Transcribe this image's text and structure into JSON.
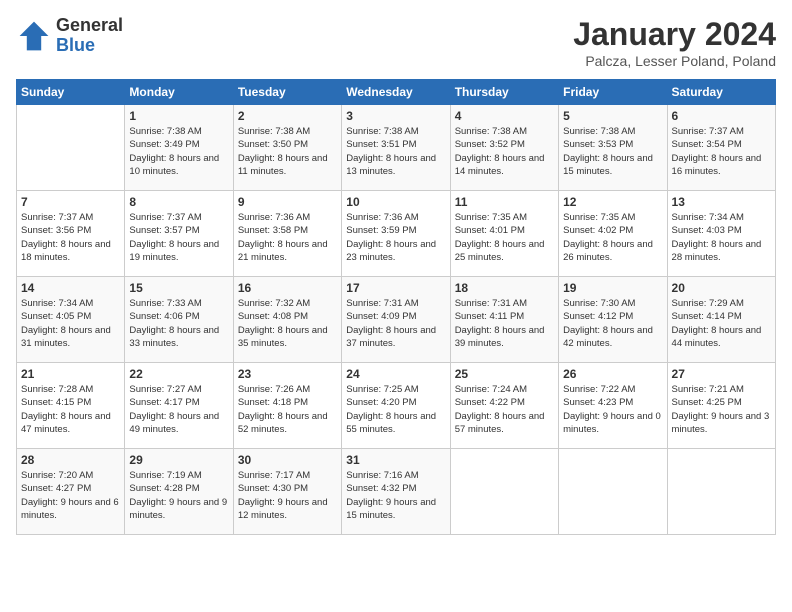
{
  "logo": {
    "general": "General",
    "blue": "Blue"
  },
  "title": "January 2024",
  "subtitle": "Palcza, Lesser Poland, Poland",
  "weekdays": [
    "Sunday",
    "Monday",
    "Tuesday",
    "Wednesday",
    "Thursday",
    "Friday",
    "Saturday"
  ],
  "weeks": [
    [
      {
        "day": "",
        "sunrise": "",
        "sunset": "",
        "daylight": ""
      },
      {
        "day": "1",
        "sunrise": "Sunrise: 7:38 AM",
        "sunset": "Sunset: 3:49 PM",
        "daylight": "Daylight: 8 hours and 10 minutes."
      },
      {
        "day": "2",
        "sunrise": "Sunrise: 7:38 AM",
        "sunset": "Sunset: 3:50 PM",
        "daylight": "Daylight: 8 hours and 11 minutes."
      },
      {
        "day": "3",
        "sunrise": "Sunrise: 7:38 AM",
        "sunset": "Sunset: 3:51 PM",
        "daylight": "Daylight: 8 hours and 13 minutes."
      },
      {
        "day": "4",
        "sunrise": "Sunrise: 7:38 AM",
        "sunset": "Sunset: 3:52 PM",
        "daylight": "Daylight: 8 hours and 14 minutes."
      },
      {
        "day": "5",
        "sunrise": "Sunrise: 7:38 AM",
        "sunset": "Sunset: 3:53 PM",
        "daylight": "Daylight: 8 hours and 15 minutes."
      },
      {
        "day": "6",
        "sunrise": "Sunrise: 7:37 AM",
        "sunset": "Sunset: 3:54 PM",
        "daylight": "Daylight: 8 hours and 16 minutes."
      }
    ],
    [
      {
        "day": "7",
        "sunrise": "Sunrise: 7:37 AM",
        "sunset": "Sunset: 3:56 PM",
        "daylight": "Daylight: 8 hours and 18 minutes."
      },
      {
        "day": "8",
        "sunrise": "Sunrise: 7:37 AM",
        "sunset": "Sunset: 3:57 PM",
        "daylight": "Daylight: 8 hours and 19 minutes."
      },
      {
        "day": "9",
        "sunrise": "Sunrise: 7:36 AM",
        "sunset": "Sunset: 3:58 PM",
        "daylight": "Daylight: 8 hours and 21 minutes."
      },
      {
        "day": "10",
        "sunrise": "Sunrise: 7:36 AM",
        "sunset": "Sunset: 3:59 PM",
        "daylight": "Daylight: 8 hours and 23 minutes."
      },
      {
        "day": "11",
        "sunrise": "Sunrise: 7:35 AM",
        "sunset": "Sunset: 4:01 PM",
        "daylight": "Daylight: 8 hours and 25 minutes."
      },
      {
        "day": "12",
        "sunrise": "Sunrise: 7:35 AM",
        "sunset": "Sunset: 4:02 PM",
        "daylight": "Daylight: 8 hours and 26 minutes."
      },
      {
        "day": "13",
        "sunrise": "Sunrise: 7:34 AM",
        "sunset": "Sunset: 4:03 PM",
        "daylight": "Daylight: 8 hours and 28 minutes."
      }
    ],
    [
      {
        "day": "14",
        "sunrise": "Sunrise: 7:34 AM",
        "sunset": "Sunset: 4:05 PM",
        "daylight": "Daylight: 8 hours and 31 minutes."
      },
      {
        "day": "15",
        "sunrise": "Sunrise: 7:33 AM",
        "sunset": "Sunset: 4:06 PM",
        "daylight": "Daylight: 8 hours and 33 minutes."
      },
      {
        "day": "16",
        "sunrise": "Sunrise: 7:32 AM",
        "sunset": "Sunset: 4:08 PM",
        "daylight": "Daylight: 8 hours and 35 minutes."
      },
      {
        "day": "17",
        "sunrise": "Sunrise: 7:31 AM",
        "sunset": "Sunset: 4:09 PM",
        "daylight": "Daylight: 8 hours and 37 minutes."
      },
      {
        "day": "18",
        "sunrise": "Sunrise: 7:31 AM",
        "sunset": "Sunset: 4:11 PM",
        "daylight": "Daylight: 8 hours and 39 minutes."
      },
      {
        "day": "19",
        "sunrise": "Sunrise: 7:30 AM",
        "sunset": "Sunset: 4:12 PM",
        "daylight": "Daylight: 8 hours and 42 minutes."
      },
      {
        "day": "20",
        "sunrise": "Sunrise: 7:29 AM",
        "sunset": "Sunset: 4:14 PM",
        "daylight": "Daylight: 8 hours and 44 minutes."
      }
    ],
    [
      {
        "day": "21",
        "sunrise": "Sunrise: 7:28 AM",
        "sunset": "Sunset: 4:15 PM",
        "daylight": "Daylight: 8 hours and 47 minutes."
      },
      {
        "day": "22",
        "sunrise": "Sunrise: 7:27 AM",
        "sunset": "Sunset: 4:17 PM",
        "daylight": "Daylight: 8 hours and 49 minutes."
      },
      {
        "day": "23",
        "sunrise": "Sunrise: 7:26 AM",
        "sunset": "Sunset: 4:18 PM",
        "daylight": "Daylight: 8 hours and 52 minutes."
      },
      {
        "day": "24",
        "sunrise": "Sunrise: 7:25 AM",
        "sunset": "Sunset: 4:20 PM",
        "daylight": "Daylight: 8 hours and 55 minutes."
      },
      {
        "day": "25",
        "sunrise": "Sunrise: 7:24 AM",
        "sunset": "Sunset: 4:22 PM",
        "daylight": "Daylight: 8 hours and 57 minutes."
      },
      {
        "day": "26",
        "sunrise": "Sunrise: 7:22 AM",
        "sunset": "Sunset: 4:23 PM",
        "daylight": "Daylight: 9 hours and 0 minutes."
      },
      {
        "day": "27",
        "sunrise": "Sunrise: 7:21 AM",
        "sunset": "Sunset: 4:25 PM",
        "daylight": "Daylight: 9 hours and 3 minutes."
      }
    ],
    [
      {
        "day": "28",
        "sunrise": "Sunrise: 7:20 AM",
        "sunset": "Sunset: 4:27 PM",
        "daylight": "Daylight: 9 hours and 6 minutes."
      },
      {
        "day": "29",
        "sunrise": "Sunrise: 7:19 AM",
        "sunset": "Sunset: 4:28 PM",
        "daylight": "Daylight: 9 hours and 9 minutes."
      },
      {
        "day": "30",
        "sunrise": "Sunrise: 7:17 AM",
        "sunset": "Sunset: 4:30 PM",
        "daylight": "Daylight: 9 hours and 12 minutes."
      },
      {
        "day": "31",
        "sunrise": "Sunrise: 7:16 AM",
        "sunset": "Sunset: 4:32 PM",
        "daylight": "Daylight: 9 hours and 15 minutes."
      },
      {
        "day": "",
        "sunrise": "",
        "sunset": "",
        "daylight": ""
      },
      {
        "day": "",
        "sunrise": "",
        "sunset": "",
        "daylight": ""
      },
      {
        "day": "",
        "sunrise": "",
        "sunset": "",
        "daylight": ""
      }
    ]
  ]
}
